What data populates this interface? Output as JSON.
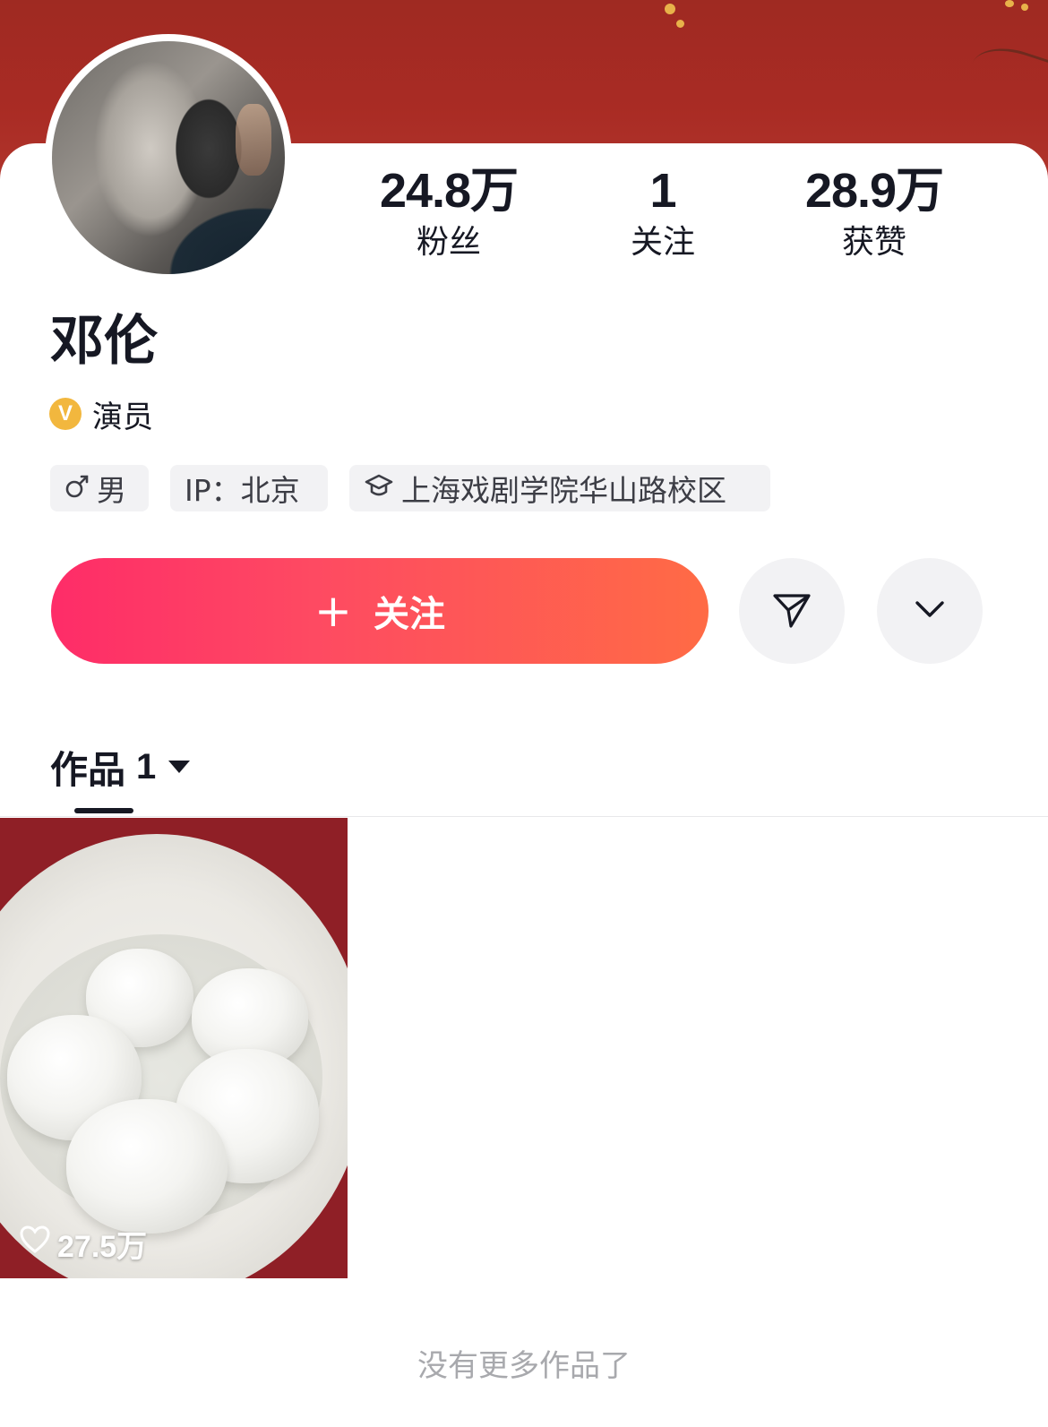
{
  "profile": {
    "name": "邓伦",
    "verification": "演员",
    "verify_badge": "V",
    "tags": {
      "gender": "男",
      "ip": "IP：北京",
      "school": "上海戏剧学院华山路校区"
    }
  },
  "stats": {
    "followers": {
      "value": "24.8万",
      "label": "粉丝"
    },
    "following": {
      "value": "1",
      "label": "关注"
    },
    "likes": {
      "value": "28.9万",
      "label": "获赞"
    }
  },
  "actions": {
    "follow_label": "关注",
    "follow_plus": "+"
  },
  "tabs": {
    "works_label": "作品",
    "works_count": "1"
  },
  "videos": [
    {
      "likes": "27.5万"
    }
  ],
  "footer": {
    "no_more": "没有更多作品了"
  },
  "icons": [
    "gender-male-icon",
    "graduation-cap-icon",
    "send-icon",
    "chevron-down-icon",
    "heart-icon"
  ],
  "colors": {
    "banner": "#a92b24",
    "follow_start": "#fe2c68",
    "follow_end": "#ff6b45",
    "verify_badge": "#f2b73e"
  }
}
